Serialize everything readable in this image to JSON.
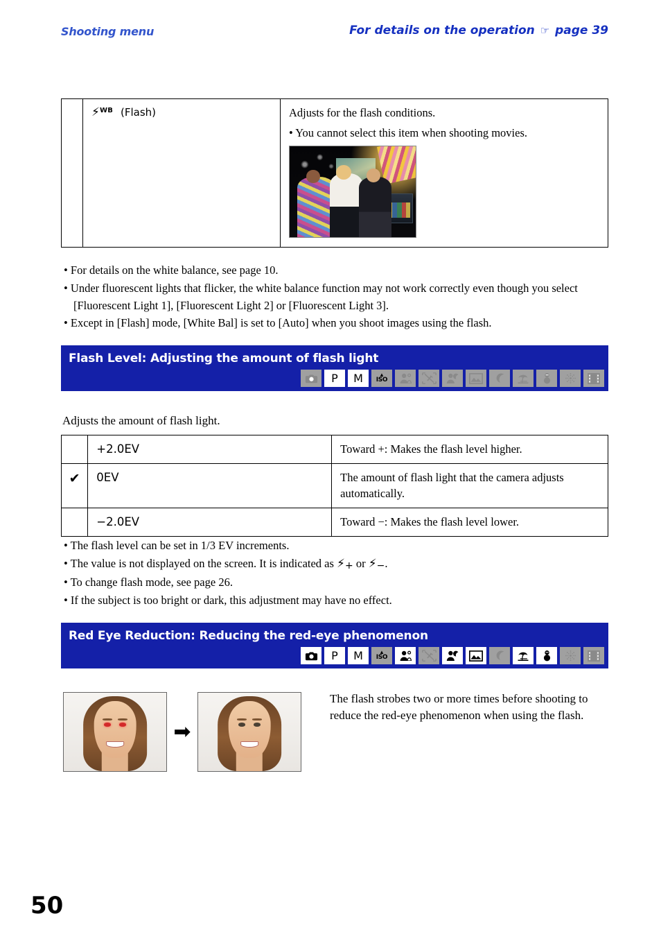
{
  "header": {
    "left": "Shooting menu",
    "right_prefix": "For details on the operation",
    "hand_icon": "☞",
    "right_suffix": "page 39"
  },
  "flash_wb_table": {
    "rows": [
      {
        "check": "",
        "label_bolt": "⚡",
        "label_sup": "WB",
        "label_text": "(Flash)",
        "desc_lines": [
          "Adjusts for the flash conditions.",
          "You cannot select this item when shooting movies."
        ],
        "photo_alt": "night-scene-sample-photo"
      }
    ]
  },
  "white_balance_notes": [
    "For details on the white balance, see page 10.",
    "Under fluorescent lights that flicker, the white balance function may not work correctly even though you select [Fluorescent Light 1], [Fluorescent Light 2] or [Fluorescent Light 3].",
    "Except in [Flash] mode, [White Bal] is set to [Auto] when you shoot images using the flash."
  ],
  "flash_level_section": {
    "banner_title": "Flash Level: Adjusting the amount of flash light",
    "mode_icons": [
      {
        "name": "auto-camera",
        "glyph": "camera",
        "active": false
      },
      {
        "name": "program-p",
        "glyph": "P",
        "active": true
      },
      {
        "name": "manual-m",
        "glyph": "M",
        "active": true
      },
      {
        "name": "high-iso",
        "glyph": "ISO",
        "active": false
      },
      {
        "name": "soft-snap",
        "glyph": "portrait",
        "active": false
      },
      {
        "name": "no-flash",
        "glyph": "crossed",
        "active": false
      },
      {
        "name": "twilight-portrait",
        "glyph": "person-moon",
        "active": false
      },
      {
        "name": "landscape",
        "glyph": "landscape",
        "active": false
      },
      {
        "name": "twilight",
        "glyph": "moon",
        "active": false
      },
      {
        "name": "beach",
        "glyph": "beach",
        "active": false
      },
      {
        "name": "snow",
        "glyph": "snow",
        "active": false
      },
      {
        "name": "fireworks",
        "glyph": "fireworks",
        "active": false
      },
      {
        "name": "movie",
        "glyph": "film",
        "active": false
      }
    ],
    "intro": "Adjusts the amount of flash light.",
    "table_rows": [
      {
        "check": "",
        "label": "+2.0EV",
        "desc": "Toward +: Makes the flash level higher."
      },
      {
        "check": "✔",
        "label": "0EV",
        "desc": "The amount of flash light that the camera adjusts automatically."
      },
      {
        "check": "",
        "label": "−2.0EV",
        "desc": "Toward −: Makes the flash level lower."
      }
    ],
    "notes": [
      {
        "text_before": "The flash level can be set in 1/3 EV increments.",
        "has_icons": false
      },
      {
        "text_before": "The value is not displayed on the screen. It is indicated as ",
        "icon_a": "⚡",
        "sub_a": "+",
        "middle": " or ",
        "icon_b": "⚡",
        "sub_b": "−",
        "text_after": ".",
        "has_icons": true
      },
      {
        "text_before": "To change flash mode, see page 26.",
        "has_icons": false
      },
      {
        "text_before": "If the subject is too bright or dark, this adjustment may have no effect.",
        "has_icons": false
      }
    ]
  },
  "red_eye_section": {
    "banner_title": "Red Eye Reduction: Reducing the red-eye phenomenon",
    "mode_icons": [
      {
        "name": "auto-camera",
        "glyph": "camera",
        "active": true
      },
      {
        "name": "program-p",
        "glyph": "P",
        "active": true
      },
      {
        "name": "manual-m",
        "glyph": "M",
        "active": true
      },
      {
        "name": "high-iso",
        "glyph": "ISO",
        "active": false
      },
      {
        "name": "soft-snap",
        "glyph": "portrait",
        "active": true
      },
      {
        "name": "no-flash",
        "glyph": "crossed",
        "active": false
      },
      {
        "name": "twilight-portrait",
        "glyph": "person-moon",
        "active": true
      },
      {
        "name": "landscape",
        "glyph": "landscape",
        "active": true
      },
      {
        "name": "twilight",
        "glyph": "moon",
        "active": false
      },
      {
        "name": "beach",
        "glyph": "beach",
        "active": true
      },
      {
        "name": "snow",
        "glyph": "snow",
        "active": true
      },
      {
        "name": "fireworks",
        "glyph": "fireworks",
        "active": false
      },
      {
        "name": "movie",
        "glyph": "film",
        "active": false
      }
    ],
    "before_photo_alt": "portrait-with-red-eye",
    "arrow": "➡",
    "after_photo_alt": "portrait-red-eye-corrected",
    "description": "The flash strobes two or more times before shooting to reduce the red-eye phenomenon when using the flash."
  },
  "folio": "50",
  "colors": {
    "banner_blue": "#1420a8",
    "header_blue": "#1530c0",
    "icon_gray": "#a0a0a0"
  }
}
